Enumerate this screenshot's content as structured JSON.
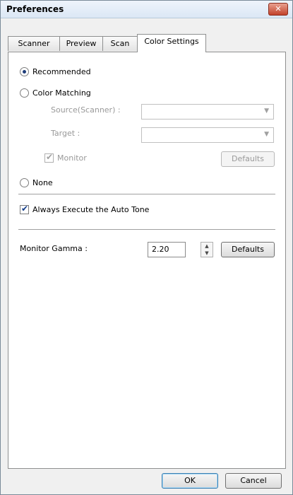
{
  "window": {
    "title": "Preferences",
    "close_glyph": "✕"
  },
  "tabs": [
    {
      "label": "Scanner",
      "active": false
    },
    {
      "label": "Preview",
      "active": false
    },
    {
      "label": "Scan",
      "active": false
    },
    {
      "label": "Color Settings",
      "active": true
    }
  ],
  "color_settings": {
    "recommended_label": "Recommended",
    "recommended_selected": true,
    "color_matching_label": "Color Matching",
    "color_matching_selected": false,
    "source_label": "Source(Scanner) :",
    "source_value": "",
    "target_label": "Target :",
    "target_value": "",
    "monitor_label": "Monitor",
    "monitor_checked": true,
    "color_matching_defaults_label": "Defaults",
    "none_label": "None",
    "none_selected": false,
    "auto_tone_label": "Always Execute the Auto Tone",
    "auto_tone_checked": true,
    "monitor_gamma_label": "Monitor Gamma :",
    "monitor_gamma_value": "2.20",
    "gamma_defaults_label": "Defaults"
  },
  "footer": {
    "ok_label": "OK",
    "cancel_label": "Cancel"
  },
  "icons": {
    "check": "✔",
    "dropdown": "▼",
    "spin_up": "▲",
    "spin_down": "▼"
  }
}
